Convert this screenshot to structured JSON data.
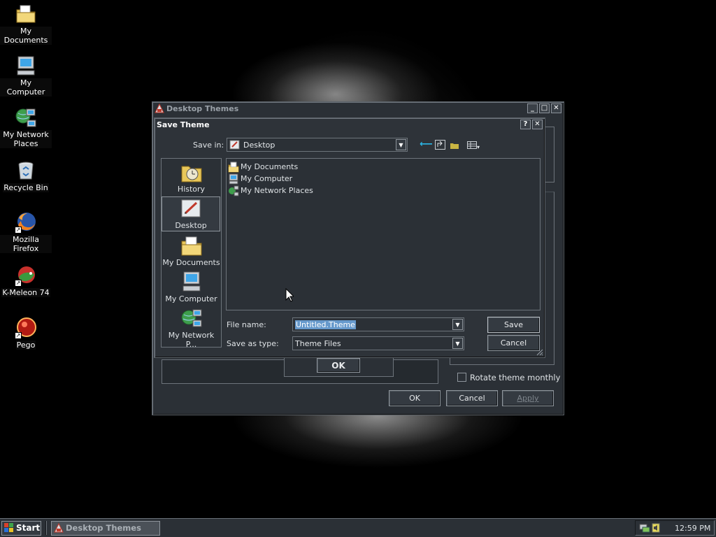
{
  "desktop_icons": [
    {
      "label": "My Documents",
      "icon": "folder-documents-icon"
    },
    {
      "label": "My Computer",
      "icon": "computer-icon"
    },
    {
      "label": "My Network Places",
      "icon": "network-places-icon"
    },
    {
      "label": "Recycle Bin",
      "icon": "recycle-bin-icon"
    },
    {
      "label": "Mozilla Firefox",
      "icon": "firefox-icon"
    },
    {
      "label": "K-Meleon 74",
      "icon": "kmeleon-icon"
    },
    {
      "label": "Pego",
      "icon": "pego-icon"
    }
  ],
  "themes_window": {
    "title": "Desktop Themes",
    "rotate_label": "Rotate theme monthly",
    "rotate_checked": false,
    "ok_label": "OK",
    "cancel_label": "Cancel",
    "apply_label": "Apply",
    "inner_ok_label": "OK"
  },
  "save_dialog": {
    "title": "Save Theme",
    "help_label": "?",
    "close_label": "✕",
    "save_in_label": "Save in:",
    "save_in_value": "Desktop",
    "places": [
      {
        "label": "History",
        "icon": "history-icon"
      },
      {
        "label": "Desktop",
        "icon": "desktop-icon"
      },
      {
        "label": "My Documents",
        "icon": "folder-documents-icon"
      },
      {
        "label": "My Computer",
        "icon": "computer-icon"
      },
      {
        "label": "My Network P...",
        "icon": "network-places-icon"
      }
    ],
    "files": [
      {
        "label": "My Documents",
        "icon": "folder-documents-icon"
      },
      {
        "label": "My Computer",
        "icon": "computer-icon"
      },
      {
        "label": "My Network Places",
        "icon": "network-places-icon"
      }
    ],
    "file_name_label": "File name:",
    "file_name_value": "Untitled.Theme",
    "save_type_label": "Save as type:",
    "save_type_value": "Theme Files",
    "save_button": "Save",
    "cancel_button": "Cancel"
  },
  "taskbar": {
    "start_label": "Start",
    "task_label": "Desktop Themes",
    "clock": "12:59 PM"
  },
  "colors": {
    "accent": "#6699cc",
    "window_bg": "#2b3036"
  }
}
